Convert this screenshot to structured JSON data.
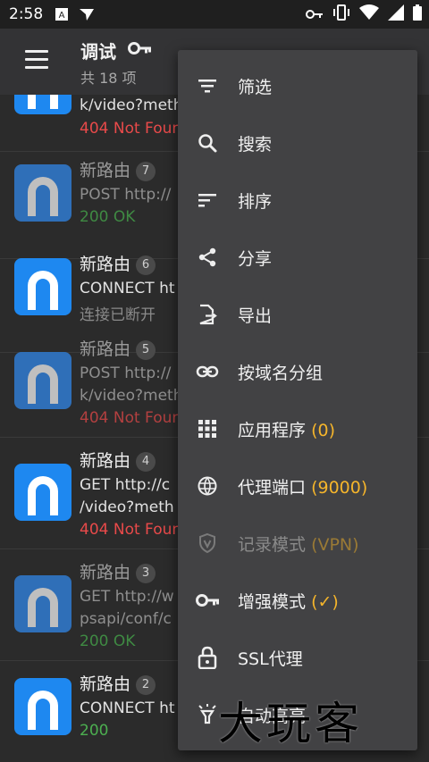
{
  "status_bar": {
    "time": "2:58",
    "icons": [
      "a-box-icon",
      "signal-flag-icon",
      "key-icon",
      "vibrate-icon",
      "wifi-icon",
      "battery-icon"
    ]
  },
  "appbar": {
    "title": "调试",
    "subtitle": "共 18 项"
  },
  "list": [
    {
      "name": "",
      "badge": "",
      "line1": "k/video?meth",
      "line2": "404 Not Foun",
      "status": "error",
      "bright": true
    },
    {
      "name": "新路由",
      "badge": "7",
      "line1": "POST http://",
      "line2": "200 OK",
      "status": "ok",
      "bright": false
    },
    {
      "name": "新路由",
      "badge": "6",
      "line1": "CONNECT ht",
      "line2": "连接已断开",
      "status": "grey",
      "bright": true
    },
    {
      "name": "新路由",
      "badge": "5",
      "line1": "POST http://",
      "line1b": "k/video?meth",
      "line2": "404 Not Foun",
      "status": "error",
      "bright": false
    },
    {
      "name": "新路由",
      "badge": "4",
      "line1": "GET http://c",
      "line1b": "/video?meth",
      "line2": "404 Not Foun",
      "status": "error",
      "bright": true
    },
    {
      "name": "新路由",
      "badge": "3",
      "line1": "GET http://w",
      "line1b": "psapi/conf/c",
      "line2": "200 OK",
      "status": "ok",
      "bright": false
    },
    {
      "name": "新路由",
      "badge": "2",
      "line1": "CONNECT ht",
      "line2": "200",
      "status": "ok",
      "bright": true
    }
  ],
  "menu": [
    {
      "label": "筛选",
      "icon": "filter-icon"
    },
    {
      "label": "搜索",
      "icon": "search-icon"
    },
    {
      "label": "排序",
      "icon": "sort-icon"
    },
    {
      "label": "分享",
      "icon": "share-icon"
    },
    {
      "label": "导出",
      "icon": "export-icon"
    },
    {
      "label": "按域名分组",
      "icon": "link-icon"
    },
    {
      "label": "应用程序",
      "extra": "(0)",
      "icon": "apps-grid-icon"
    },
    {
      "label": "代理端口",
      "extra": "(9000)",
      "icon": "globe-icon"
    },
    {
      "label": "记录模式",
      "extra": "(VPN)",
      "icon": "vpn-shield-icon",
      "disabled": true
    },
    {
      "label": "增强模式",
      "extra": "(✓)",
      "icon": "key-icon"
    },
    {
      "label": "SSL代理",
      "icon": "lock-icon"
    },
    {
      "label": "自动高亮",
      "icon": "highlight-icon"
    }
  ],
  "watermark": "大玩客",
  "colors": {
    "accent": "#f5b52b",
    "error": "#e84a4a",
    "ok": "#4caf50",
    "icon_blue": "#1e88f0"
  }
}
